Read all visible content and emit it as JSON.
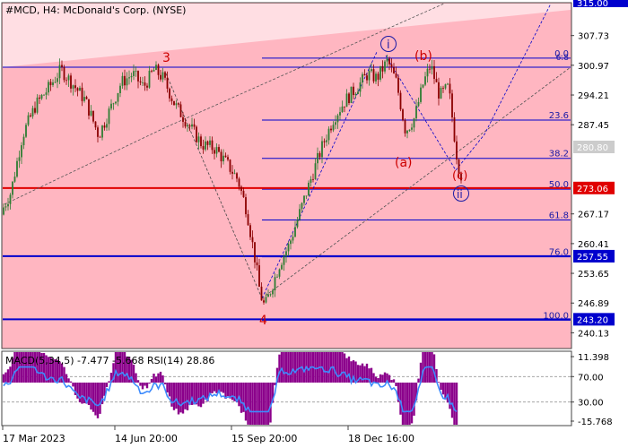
{
  "header": {
    "title": "#MCD, H4:  McDonald's Corp. (NYSE)"
  },
  "colors": {
    "background": "#ffffff",
    "plot_fill": "#ffb6c1",
    "wedge_fill": "#ff9aa8",
    "axis_text": "#000000",
    "price_line_blue": "#0000cd",
    "price_line_red": "#e00000",
    "candle_up": "#2e7d32",
    "candle_down": "#8b0000",
    "wave_label_red": "#cc0000",
    "wave_label_blue": "#1a1aa6",
    "macd_hist": "#8b008b",
    "rsi_line": "#3d8bfd",
    "highlight_box": "#cccccc"
  },
  "price_axis": {
    "ticks": [
      "307.73",
      "300.97",
      "294.21",
      "287.45",
      "267.17",
      "260.41",
      "253.65",
      "246.89",
      "240.13"
    ],
    "top_label": "315.00",
    "highlight_label": "280.80"
  },
  "price_levels": [
    {
      "id": "level-273",
      "label": "273.06",
      "value": 273.06,
      "color": "#e00000"
    },
    {
      "id": "level-257",
      "label": "257.55",
      "value": 257.55,
      "color": "#0000cd"
    },
    {
      "id": "level-243",
      "label": "243.20",
      "value": 243.2,
      "color": "#0000cd"
    }
  ],
  "fibonacci": {
    "levels": [
      {
        "label": "0.0",
        "value": 302.6
      },
      {
        "label": "23.6",
        "value": 288.5
      },
      {
        "label": "38.2",
        "value": 279.8
      },
      {
        "label": "50.0",
        "value": 272.8
      },
      {
        "label": "61.8",
        "value": 265.8
      },
      {
        "label": "76.0",
        "value": 257.4
      },
      {
        "label": "100.0",
        "value": 243.0
      }
    ],
    "extra_label": "6.8"
  },
  "wave_labels": {
    "w3": "3",
    "w4": "4",
    "wi": "i",
    "wii": "ii",
    "wa": "(a)",
    "wb": "(b)",
    "wc": "(c)"
  },
  "indicator": {
    "label": "MACD(5,34,5) -7.477 -5.668 RSI(14) 28.86",
    "ticks": [
      "11.398",
      "70.00",
      "30.00",
      "-15.768"
    ]
  },
  "time_axis": {
    "labels": [
      "17 Mar 2023",
      "14 Jun 20:00",
      "15 Sep 20:00",
      "18 Dec 16:00"
    ]
  },
  "chart_data": {
    "type": "candlestick",
    "symbol": "#MCD",
    "timeframe": "H4",
    "title": "#MCD, H4:  McDonald's Corp. (NYSE)",
    "ylim": [
      236.75,
      315.0
    ],
    "x_tick_labels": [
      "17 Mar 2023",
      "14 Jun 20:00",
      "15 Sep 20:00",
      "18 Dec 16:00"
    ],
    "price_path": [
      [
        0,
        267
      ],
      [
        12,
        272
      ],
      [
        25,
        285
      ],
      [
        40,
        292
      ],
      [
        55,
        296
      ],
      [
        68,
        300
      ],
      [
        80,
        297
      ],
      [
        95,
        293
      ],
      [
        110,
        285
      ],
      [
        125,
        292
      ],
      [
        135,
        297
      ],
      [
        148,
        299
      ],
      [
        160,
        296
      ],
      [
        172,
        300
      ],
      [
        182,
        298
      ],
      [
        195,
        292
      ],
      [
        205,
        289
      ],
      [
        215,
        286
      ],
      [
        225,
        283
      ],
      [
        240,
        282
      ],
      [
        255,
        278
      ],
      [
        265,
        275
      ],
      [
        275,
        268
      ],
      [
        285,
        256
      ],
      [
        290,
        249
      ],
      [
        295,
        246
      ],
      [
        302,
        250
      ],
      [
        312,
        256
      ],
      [
        322,
        260
      ],
      [
        335,
        268
      ],
      [
        348,
        276
      ],
      [
        360,
        283
      ],
      [
        372,
        289
      ],
      [
        385,
        293
      ],
      [
        398,
        296
      ],
      [
        410,
        299
      ],
      [
        420,
        298
      ],
      [
        432,
        302
      ],
      [
        442,
        297
      ],
      [
        452,
        286
      ],
      [
        462,
        289
      ],
      [
        472,
        297
      ],
      [
        480,
        301
      ],
      [
        490,
        294
      ],
      [
        500,
        296
      ],
      [
        510,
        279
      ],
      [
        514,
        276
      ]
    ],
    "horizontal_levels": [
      273.06,
      257.55,
      243.2
    ],
    "fibonacci_retracement": {
      "0.0": 302.6,
      "23.6": 288.5,
      "38.2": 279.8,
      "50.0": 272.8,
      "61.8": 265.8,
      "76.0": 257.4,
      "100.0": 243.0
    },
    "indicator": {
      "name": "MACD(5,34,5) / RSI(14)",
      "macd_main": -7.477,
      "macd_signal": -5.668,
      "rsi": 28.86,
      "ylim": [
        -15.768,
        11.398
      ],
      "rsi_levels": [
        30,
        70
      ]
    }
  }
}
